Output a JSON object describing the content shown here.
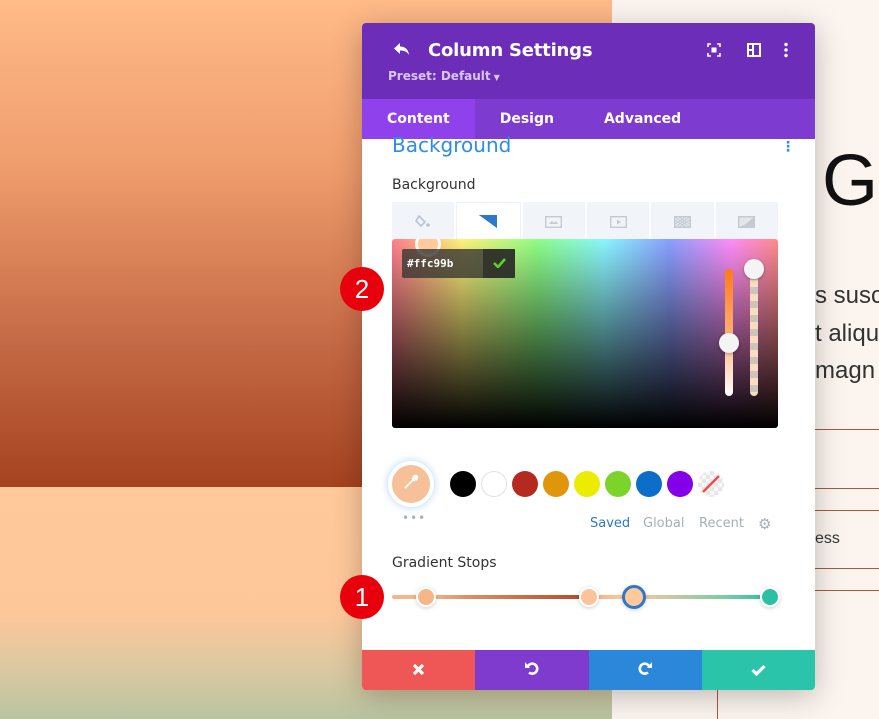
{
  "page": {
    "heading_letter": "G",
    "body_lines": [
      "s susc",
      "t aliqu",
      "magn"
    ],
    "menu_text": "ess"
  },
  "panel": {
    "title": "Column Settings",
    "preset": "Preset: Default",
    "icons": [
      "back-icon",
      "fullscreen-icon",
      "split-view-icon",
      "more-options-icon"
    ],
    "tabs": [
      {
        "label": "Content",
        "active": true
      },
      {
        "label": "Design",
        "active": false
      },
      {
        "label": "Advanced",
        "active": false
      }
    ],
    "section_title": "Background",
    "background_label": "Background",
    "background_types": [
      {
        "name": "color",
        "icon": "paint-bucket-icon",
        "active": false
      },
      {
        "name": "gradient",
        "icon": "gradient-icon",
        "active": true
      },
      {
        "name": "image",
        "icon": "image-icon",
        "active": false
      },
      {
        "name": "video",
        "icon": "video-icon",
        "active": false
      },
      {
        "name": "pattern",
        "icon": "pattern-icon",
        "active": false
      },
      {
        "name": "mask",
        "icon": "mask-icon",
        "active": false
      }
    ],
    "color_picker": {
      "hex_value": "#ffc99b"
    },
    "swatches": [
      {
        "name": "black",
        "color": "#000000"
      },
      {
        "name": "white",
        "color": "#ffffff"
      },
      {
        "name": "red",
        "color": "#b52a1f"
      },
      {
        "name": "orange",
        "color": "#e0960a"
      },
      {
        "name": "yellow",
        "color": "#ecec00"
      },
      {
        "name": "green",
        "color": "#7cd42b"
      },
      {
        "name": "blue",
        "color": "#0c6ec7"
      },
      {
        "name": "purple",
        "color": "#8300e8"
      },
      {
        "name": "none",
        "color": "transparent"
      }
    ],
    "current_color": "#f6c198",
    "palette_tabs": [
      {
        "label": "Saved",
        "active": true
      },
      {
        "label": "Global",
        "active": false
      },
      {
        "label": "Recent",
        "active": false
      }
    ],
    "gradient_stops_label": "Gradient Stops",
    "gradient_stops": [
      {
        "color": "#f6b68a",
        "position": 0.09,
        "selected": false
      },
      {
        "color": "#fcc39b",
        "position": 0.52,
        "selected": false
      },
      {
        "color": "#ffc99b",
        "position": 0.64,
        "selected": true
      },
      {
        "color": "#2bc0a4",
        "position": 1.0,
        "selected": false
      }
    ],
    "footer_buttons": [
      {
        "name": "cancel",
        "icon": "close-icon",
        "color": "#ef5656"
      },
      {
        "name": "undo",
        "icon": "undo-icon",
        "color": "#7f3ace"
      },
      {
        "name": "redo",
        "icon": "redo-icon",
        "color": "#2b87da"
      },
      {
        "name": "save",
        "icon": "check-icon",
        "color": "#29c4a9"
      }
    ]
  },
  "annotations": [
    {
      "label": "1",
      "target": "gradient-stops"
    },
    {
      "label": "2",
      "target": "hex-value"
    }
  ]
}
